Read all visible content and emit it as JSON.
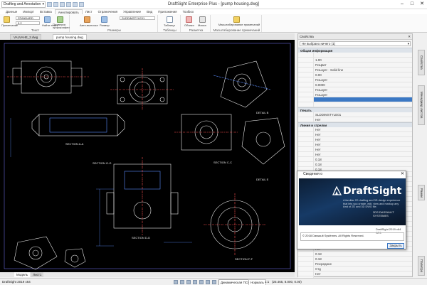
{
  "app": {
    "title": "DraftSight Enterprise Plus - [pump housing.dwg]",
    "workspace": "Drafting and Annotation",
    "window_controls": [
      "–",
      "□",
      "✕"
    ]
  },
  "ribbon_tabs": [
    "Данные",
    "Импорт",
    "Вставка",
    "Аннотировать",
    "Лист",
    "Ограничения",
    "Управление",
    "Вид",
    "Приложения",
    "Toolbox"
  ],
  "ribbon_active_tab": 3,
  "ribbon": {
    "text_group": {
      "caption": "Текст",
      "items": [
        "Примечание",
        "Найти текст",
        "Проверка орфографии"
      ],
      "style_value": "STANDARD",
      "size_value": "0.2"
    },
    "dims_group": {
      "caption": "Размеры",
      "items": [
        "Авто-выноска",
        "Размер"
      ],
      "style_value": "SLDDIMSTYLE01"
    },
    "tables_group": {
      "caption": "Таблицы",
      "items": [
        "Таблица"
      ]
    },
    "markup_group": {
      "caption": "Разметка",
      "items": [
        "Облако",
        "Маска"
      ]
    },
    "scale_group": {
      "caption": "Масштабирование примечаний",
      "items": [
        "Масштабирование примечаний"
      ]
    }
  },
  "doc_tabs": [
    {
      "label": "VALVAHE_2.dwg"
    },
    {
      "label": "pump housing.dwg",
      "active": true
    }
  ],
  "layout_tabs": [
    "Модель",
    "Лист1"
  ],
  "drawing": {
    "labels": [
      "SECTION A-A",
      "SECTION C-C",
      "DETAIL B",
      "DETAIL E",
      "SECTION D-D",
      "SECTION F-F",
      "SECTION G-G"
    ]
  },
  "properties": {
    "header": "Свойства",
    "selector": "Не выбрано ничего (1)",
    "sections": [
      {
        "title": "Общая информация",
        "rows": [
          "",
          "1.00",
          "ПоЦвет",
          "ПоLayer · Solid line",
          "0.00",
          "ПоLayer",
          "0.0000",
          "ПоLayer",
          "ПоLayer",
          "",
          ""
        ]
      },
      {
        "title": "Печать",
        "rows": [
          "SLDDIMSTYLE01",
          "Нет"
        ]
      },
      {
        "title": "Линия и стрелки",
        "rows": [
          "Нет",
          "Нет",
          "Нет",
          "Нет",
          "Нет",
          "Нет",
          "0.18",
          "0.18",
          "0.18",
          "0.18",
          "Нет",
          "Нет",
          "Нет",
          "Нет",
          "Нет",
          "0.18",
          "0.18",
          "0.18",
          "Нет",
          "Нет",
          "0.18",
          "Нет",
          "Нет",
          "Нет",
          "Нет",
          "0.18",
          "0.18",
          "Посредине",
          "Стд",
          "Нет",
          "STANDARD"
        ]
      }
    ]
  },
  "side_tabs": [
    "Свойства",
    "Менеджер листов",
    "Рамки",
    "Палитра"
  ],
  "about": {
    "title": "Сведения о",
    "logo": "DraftSight",
    "tagline": "A familiar 2D drafting and 3D design experience that lets you create, edit, view and markup any kind of 2D and 3D DWG file.",
    "brand": "3DS DASSAULT SYSTEMES",
    "version": "DraftSight 2019 x64 SP0",
    "copyright": "© 2018 Dassault Systèmes. All Rights Reserved.",
    "close": "✕",
    "ok": "Закрыть"
  },
  "status": {
    "version": "DraftSight 2019 x64",
    "dynamic_ucs": "Динамическая ПСК",
    "annotation": "Нормаль",
    "scale": "1:1",
    "coords": "(25.465, 8.000, 0.00)"
  }
}
